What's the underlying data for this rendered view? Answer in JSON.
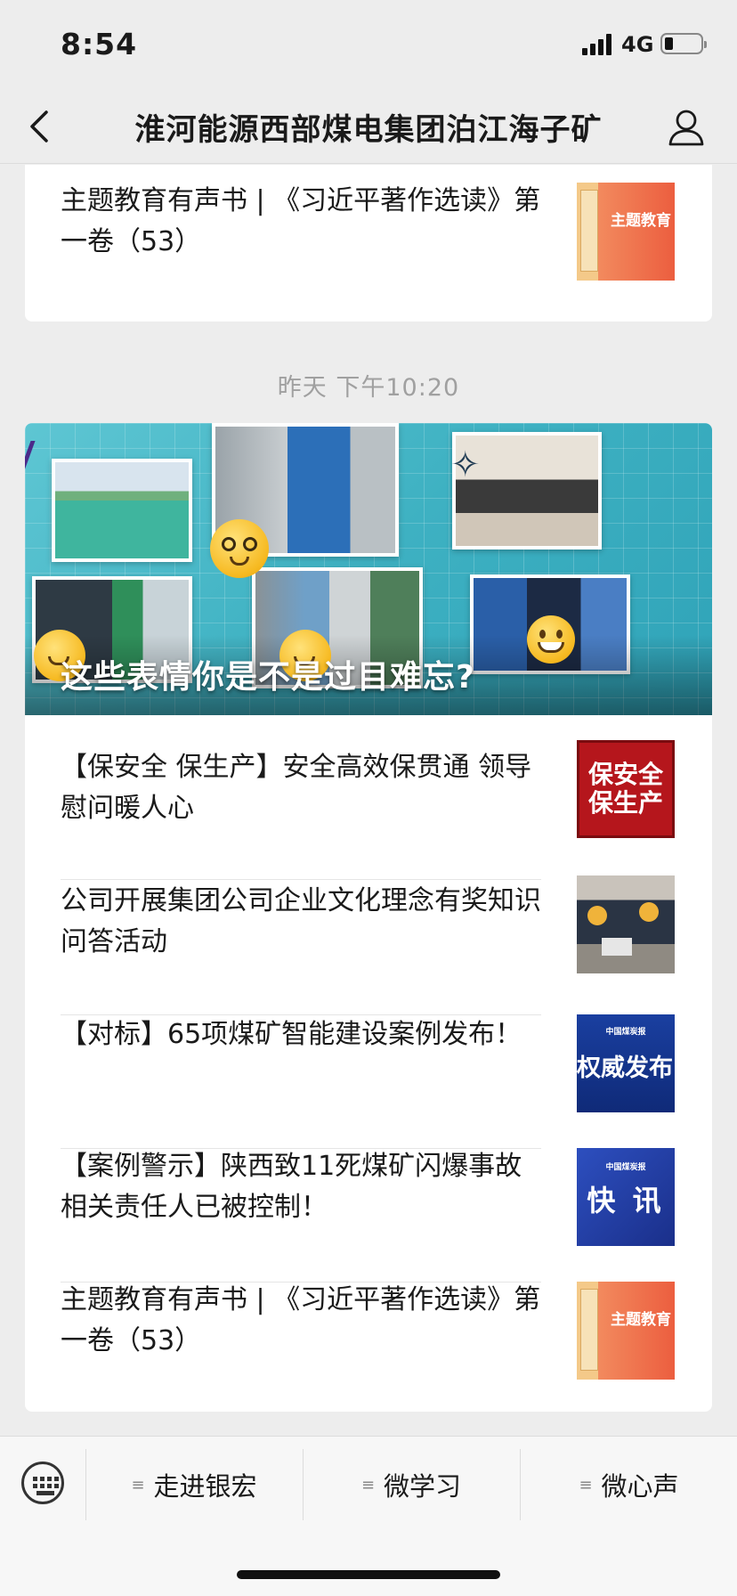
{
  "status_bar": {
    "time": "8:54",
    "network": "4G",
    "battery_percent": 15
  },
  "nav": {
    "title": "淮河能源西部煤电集团泊江海子矿",
    "back_icon": "chevron-left-icon",
    "profile_icon": "person-icon"
  },
  "top_article": {
    "title": "主题教育有声书 | 《习近平著作选读》第一卷（53）",
    "thumb_text": "主题教育"
  },
  "timestamp": "昨天 下午10:20",
  "feature": {
    "caption": "这些表情你是不是过目难忘?"
  },
  "articles": [
    {
      "title": "【保安全 保生产】安全高效保贯通 领导慰问暖人心",
      "thumb_text": "保安全保生产",
      "thumb_line1": "保安全",
      "thumb_line2": "保生产"
    },
    {
      "title": "公司开展集团公司企业文化理念有奖知识问答活动",
      "thumb_text": ""
    },
    {
      "title": "【对标】65项煤矿智能建设案例发布！",
      "thumb_small": "中国煤炭报",
      "thumb_text": "权威发布"
    },
    {
      "title": "【案例警示】陕西致11死煤矿闪爆事故相关责任人已被控制！",
      "thumb_small": "中国煤炭报",
      "thumb_text": "快 讯"
    },
    {
      "title": "主题教育有声书 | 《习近平著作选读》第一卷（53）",
      "thumb_text": "主题教育"
    }
  ],
  "tabs": [
    {
      "label": "走进银宏"
    },
    {
      "label": "微学习"
    },
    {
      "label": "微心声"
    }
  ],
  "keyboard_icon": "keyboard-icon",
  "colors": {
    "background": "#ededed",
    "card": "#ffffff",
    "banner": "#3eb1c2",
    "red_thumb": "#b5161c",
    "blue_thumb": "#1a3fa0"
  }
}
